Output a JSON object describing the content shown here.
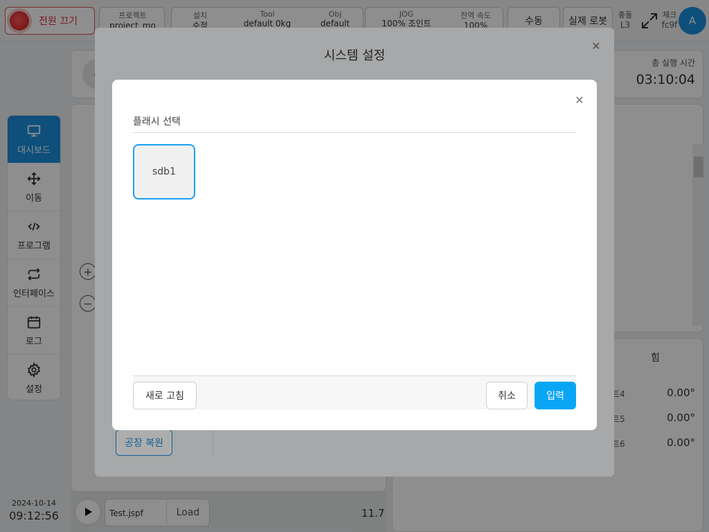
{
  "topbar": {
    "power_label": "전원 끄기",
    "project": {
      "label": "프로젝트",
      "value": "project_mo"
    },
    "install": {
      "label": "설치",
      "value": "수정"
    },
    "tool": {
      "label": "Tool",
      "value": "default   0kg"
    },
    "obj": {
      "label": "Obj",
      "value": "default"
    },
    "jog": {
      "label": "JOG",
      "value": "100%  조인트"
    },
    "global_speed": {
      "label": "전역 속도",
      "value": "100%"
    },
    "manual_label": "수동",
    "real_robot_label": "실제 로봇",
    "collision": {
      "label": "충돌",
      "value": "L3"
    },
    "check": {
      "label": "체크",
      "value": "fc9f"
    },
    "avatar_letter": "A"
  },
  "sidebar": {
    "items": [
      {
        "label": "대시보드",
        "icon": "monitor-icon"
      },
      {
        "label": "이동",
        "icon": "move-icon"
      },
      {
        "label": "프로그램",
        "icon": "code-icon"
      },
      {
        "label": "인터페이스",
        "icon": "interface-icon"
      },
      {
        "label": "로그",
        "icon": "calendar-icon"
      },
      {
        "label": "설정",
        "icon": "gear-icon"
      }
    ]
  },
  "datetime": {
    "date": "2024-10-14",
    "time": "09:12:56"
  },
  "runtime": {
    "label": "총 실행 시간",
    "value": "03:10:04"
  },
  "joints": [
    {
      "label": "트4",
      "value": "0.00°"
    },
    {
      "label": "트5",
      "value": "0.00°"
    },
    {
      "label": "트6",
      "value": "0.00°"
    }
  ],
  "force_tab_label": "힘",
  "factory_reset_label": "공장 복원",
  "bottom": {
    "file_name": "Test.jspf",
    "load_label": "Load",
    "speed_value": "11.7"
  },
  "system_modal": {
    "title": "시스템 설정"
  },
  "flash_modal": {
    "title": "플래시 선택",
    "drives": [
      "sdb1"
    ],
    "refresh_label": "새로 고침",
    "cancel_label": "취소",
    "enter_label": "입력"
  },
  "colors": {
    "accent": "#1c8fe0",
    "primary_button": "#0aa6f5",
    "power_red": "#d9362f"
  }
}
